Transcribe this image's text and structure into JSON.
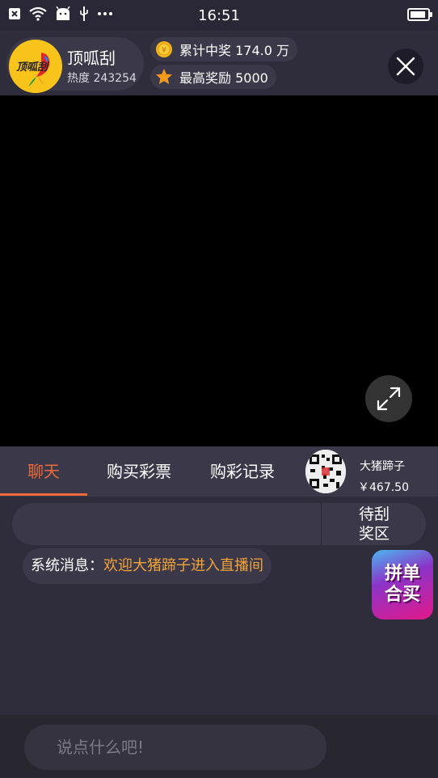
{
  "status_bar": {
    "time": "16:51",
    "battery_level": 0.9,
    "icons": [
      "close-notification-icon",
      "wifi-icon",
      "android-icon",
      "usb-icon",
      "more-dots-icon",
      "battery-icon"
    ]
  },
  "header": {
    "logo_text": "顶呱刮",
    "anchor_name": "顶呱刮",
    "heat": "热度 243254",
    "total_prize": "累计中奖 174.0 万",
    "top_reward": "最高奖励 5000",
    "icons": [
      "coin-icon",
      "star-icon",
      "close-icon"
    ]
  },
  "video": {
    "icons": [
      "expand-icon"
    ]
  },
  "tabs": {
    "items": [
      {
        "label": "聊天",
        "active": true
      },
      {
        "label": "购买彩票",
        "active": false
      },
      {
        "label": "购彩记录",
        "active": false
      }
    ],
    "user": {
      "name": "大猪蹄子",
      "balance": "￥467.50"
    }
  },
  "chat": {
    "prize_button": "待刮\n奖区",
    "prize_line1": "待刮",
    "prize_line2": "奖区",
    "messages": [
      {
        "label": "系统消息：",
        "text": "欢迎大猪蹄子进入直播间"
      }
    ],
    "promo_line1": "拼单",
    "promo_line2": "合买"
  },
  "input": {
    "placeholder": "说点什么吧!"
  },
  "colors": {
    "accent": "#ec6a3c",
    "message_text": "#f2a33a",
    "background": "#2f2d3c",
    "panel": "#3a3849"
  }
}
